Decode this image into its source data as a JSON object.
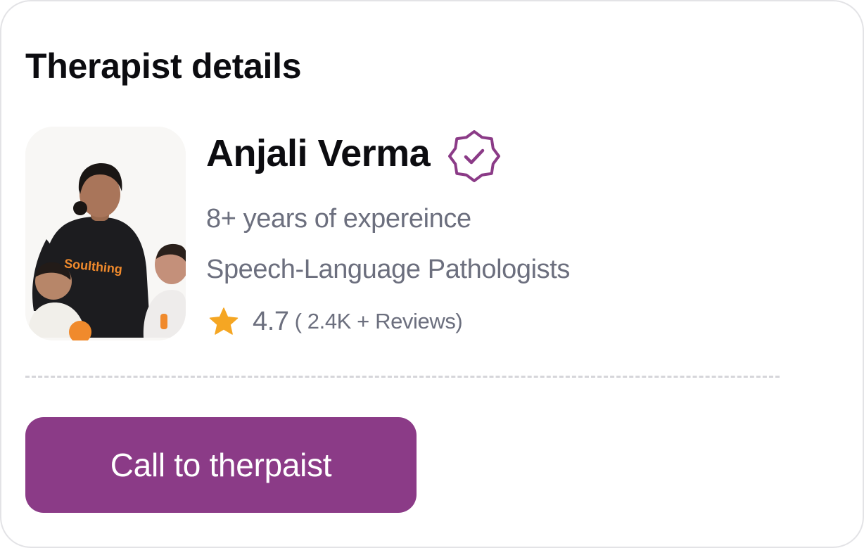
{
  "card": {
    "title": "Therapist details"
  },
  "therapist": {
    "name": "Anjali Verma",
    "experience": "8+ years of expereince",
    "specialty": "Speech-Language Pathologists",
    "rating": "4.7",
    "reviews": "( 2.4K + Reviews)",
    "photo_shirt_text": "Soulthing"
  },
  "actions": {
    "call_label": "Call to therpaist"
  },
  "icons": {
    "verified": "verified-badge-icon",
    "rating": "star-icon"
  },
  "colors": {
    "brand": "#8b3b87",
    "star": "#f5a623",
    "muted_text": "#6c6f7e",
    "shirt_text": "#f08a2c"
  }
}
